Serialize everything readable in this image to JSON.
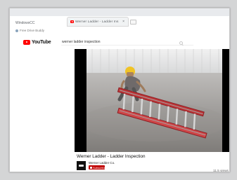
{
  "browser": {
    "label": "WindowsCC",
    "tab": {
      "title": "Werner Ladder - Ladder Ins",
      "close": "×"
    },
    "bookmark": {
      "label": "Free Drive Buddy"
    }
  },
  "youtube": {
    "logo": "YouTube",
    "search_value": "werner ladder inspection"
  },
  "video": {
    "title": "Werner Ladder - Ladder Inspection",
    "channel_name": "Werner Ladder Co.",
    "subscribe_label": "Subscribe",
    "views": "11.5 views"
  },
  "icons": {
    "tab": "youtube-icon",
    "search": "search-icon",
    "logo": "youtube-logo-icon",
    "subscribe": "subscribe-icon"
  },
  "colors": {
    "youtube_red": "#ff0000",
    "subscribe_red": "#c00000",
    "ladder_red": "#c53d3f"
  }
}
